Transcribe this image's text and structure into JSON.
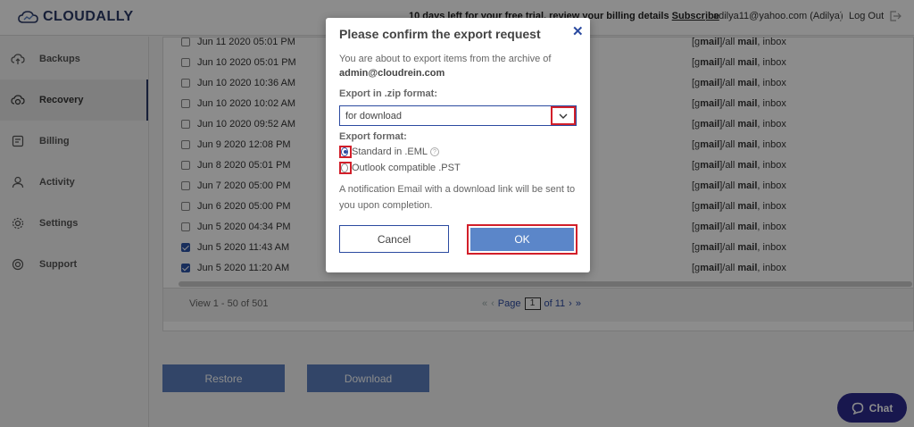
{
  "header": {
    "logo_text": "CLOUDALLY",
    "trial_text": "10 days left for your free trial, review your billing details",
    "subscribe_label": "Subscribe",
    "user": "adilya11@yahoo.com (Adilya)",
    "logout_label": "Log Out"
  },
  "sidebar": {
    "items": [
      {
        "label": "Backups",
        "icon": "cloud-upload-icon"
      },
      {
        "label": "Recovery",
        "icon": "recovery-icon"
      },
      {
        "label": "Billing",
        "icon": "billing-icon"
      },
      {
        "label": "Activity",
        "icon": "user-icon"
      },
      {
        "label": "Settings",
        "icon": "gear-icon"
      },
      {
        "label": "Support",
        "icon": "support-icon"
      }
    ]
  },
  "table": {
    "rows": [
      {
        "date": "Jun 11 2020 05:01 PM",
        "checked": false
      },
      {
        "date": "Jun 10 2020 05:01 PM",
        "checked": false
      },
      {
        "date": "Jun 10 2020 10:36 AM",
        "checked": false
      },
      {
        "date": "Jun 10 2020 10:02 AM",
        "checked": false
      },
      {
        "date": "Jun 10 2020 09:52 AM",
        "checked": false
      },
      {
        "date": "Jun 9 2020 12:08 PM",
        "checked": false
      },
      {
        "date": "Jun 8 2020 05:01 PM",
        "checked": false
      },
      {
        "date": "Jun 7 2020 05:00 PM",
        "checked": false
      },
      {
        "date": "Jun 6 2020 05:00 PM",
        "checked": false
      },
      {
        "date": "Jun 5 2020 04:34 PM",
        "checked": false
      },
      {
        "date": "Jun 5 2020 11:43 AM",
        "checked": true
      },
      {
        "date": "Jun 5 2020 11:20 AM",
        "checked": true
      }
    ],
    "folder_prefix": "[g",
    "folder_mail": "mail",
    "folder_mid": "]/all ",
    "folder_mail2": "mail",
    "folder_suffix": ", inbox"
  },
  "pagination": {
    "view_text": "View 1 - 50 of 501",
    "page_label": "Page",
    "current_page": "1",
    "of_pages": "of 11"
  },
  "actions": {
    "restore_label": "Restore",
    "download_label": "Download"
  },
  "chat": {
    "label": "Chat"
  },
  "modal": {
    "title": "Please confirm the export request",
    "close_glyph": "✕",
    "desc_prefix": "You are about to export items from the archive of",
    "account": "admin@cloudrein.com",
    "zip_label": "Export in .zip format:",
    "zip_value": "for download",
    "format_label": "Export format:",
    "format_options": [
      {
        "label": "Standard in .EML",
        "selected": true
      },
      {
        "label": "Outlook compatible .PST",
        "selected": false
      }
    ],
    "help_glyph": "?",
    "note": "A notification Email with a download link will be sent to you upon completion.",
    "cancel_label": "Cancel",
    "ok_label": "OK"
  },
  "colors": {
    "accent": "#2b4aa0",
    "button": "#5b7fbd",
    "highlight": "#d21f2a",
    "chat": "#2d2a8f"
  }
}
